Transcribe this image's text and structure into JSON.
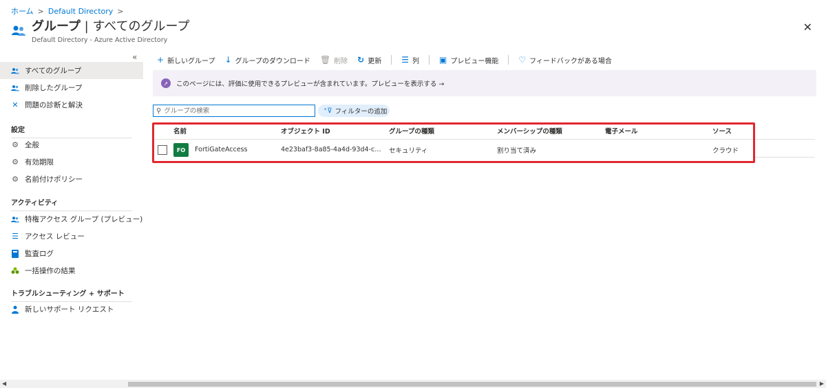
{
  "breadcrumb": {
    "home": "ホーム",
    "directory": "Default Directory"
  },
  "header": {
    "title_main": "グループ",
    "title_sep": " | ",
    "title_sub": "すべてのグループ",
    "subtitle": "Default Directory - Azure Active Directory",
    "close": "✕"
  },
  "sidebar": {
    "collapse": "«",
    "items": [
      {
        "label": "すべてのグループ",
        "icon": "users-icon"
      },
      {
        "label": "削除したグループ",
        "icon": "users-icon"
      },
      {
        "label": "問題の診断と解決",
        "icon": "wrench-icon"
      }
    ],
    "section_settings": "設定",
    "settings_items": [
      {
        "label": "全般",
        "icon": "gear-icon"
      },
      {
        "label": "有効期限",
        "icon": "gear-icon"
      },
      {
        "label": "名前付けポリシー",
        "icon": "gear-icon"
      }
    ],
    "section_activity": "アクティビティ",
    "activity_items": [
      {
        "label": "特権アクセス グループ (プレビュー)",
        "icon": "users-icon"
      },
      {
        "label": "アクセス レビュー",
        "icon": "checklist-icon"
      },
      {
        "label": "監査ログ",
        "icon": "book-icon"
      },
      {
        "label": "一括操作の結果",
        "icon": "people-green-icon"
      }
    ],
    "section_support": "トラブルシューティング + サポート",
    "support_items": [
      {
        "label": "新しいサポート リクエスト",
        "icon": "person-icon"
      }
    ]
  },
  "toolbar": {
    "new_group": "新しいグループ",
    "download": "グループのダウンロード",
    "delete": "削除",
    "refresh": "更新",
    "columns": "列",
    "preview": "プレビュー機能",
    "feedback": "フィードバックがある場合"
  },
  "banner": {
    "text": "このページには、評価に使用できるプレビューが含まれています。プレビューを表示する →"
  },
  "search": {
    "placeholder": "グループの検索"
  },
  "filter": {
    "label": "フィルターの追加"
  },
  "table": {
    "columns": [
      "名前",
      "オブジェクト ID",
      "グループの種類",
      "メンバーシップの種類",
      "電子メール",
      "ソース"
    ],
    "rows": [
      {
        "initials": "FO",
        "name": "FortiGateAccess",
        "object_id": "4e23baf3-8a85-4a4d-93d4-c08...",
        "group_type": "セキュリティ",
        "membership_type": "割り当て済み",
        "email": "",
        "source": "クラウド"
      }
    ]
  },
  "colors": {
    "accent": "#0078d4",
    "highlight": "#e2262e",
    "avatar": "#107c41",
    "banner_bg": "#f3f0f7"
  }
}
